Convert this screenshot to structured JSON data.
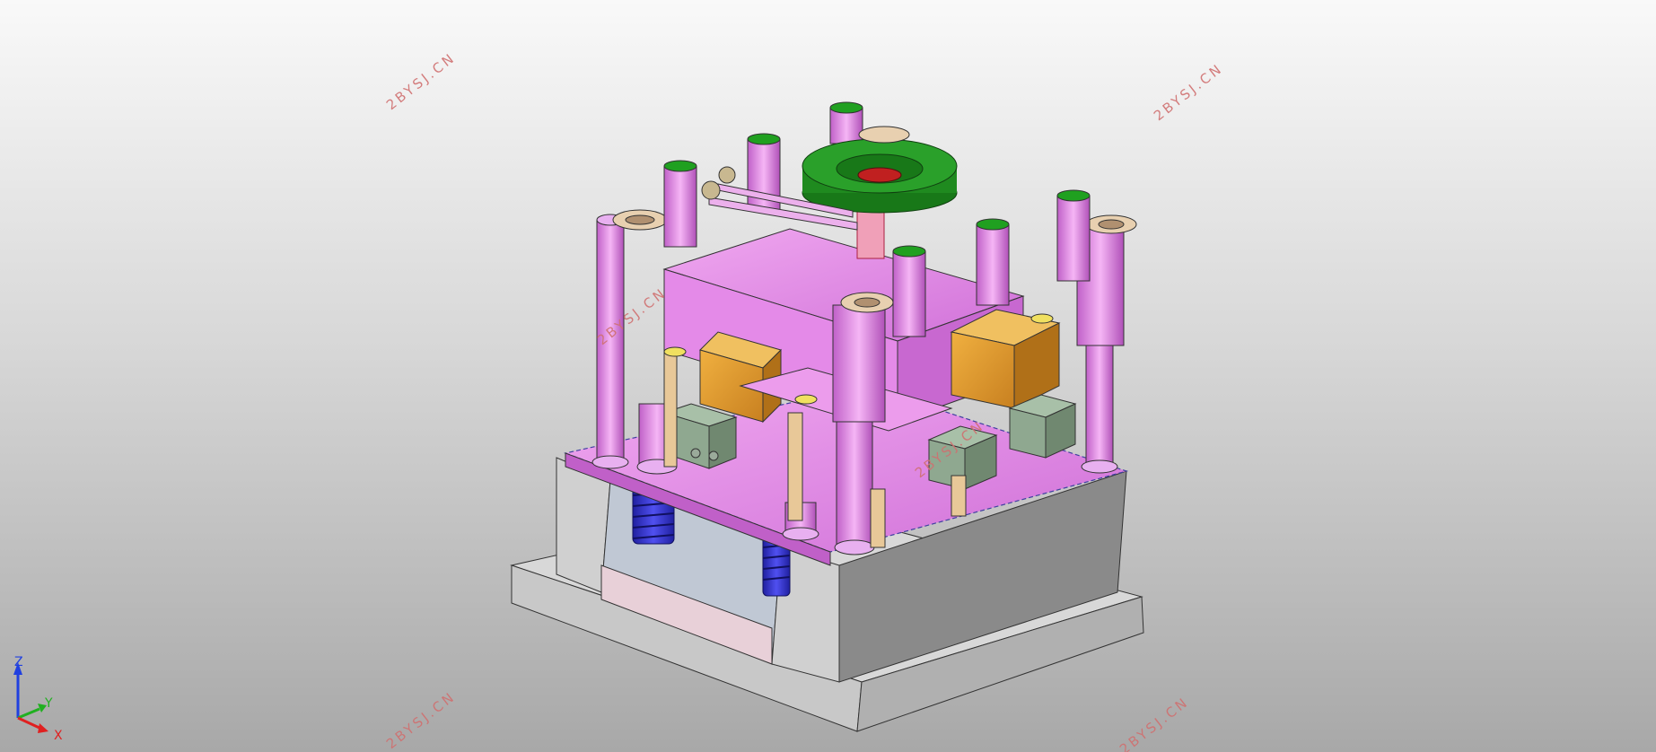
{
  "viewport": {
    "background_top": "#f9f9f9",
    "background_bottom": "#a8a8a8"
  },
  "watermarks": [
    "2BYSJ.CN",
    "2BYSJ.CN",
    "2BYSJ.CN",
    "2BYSJ.CN",
    "2BYSJ.CN",
    "2BYSJ.CN"
  ],
  "axis_triad": {
    "x_label": "X",
    "y_label": "Y",
    "z_label": "Z",
    "x_color": "#e02020",
    "y_color": "#20b020",
    "z_color": "#2040e0"
  },
  "colors": {
    "plate_pink": "#e58ae5",
    "slider_orange": "#e0a030",
    "block_green": "#8fa890",
    "flange_green": "#1f8a1f",
    "spring_blue": "#3030d0",
    "base_gray": "#c8c8c8"
  }
}
